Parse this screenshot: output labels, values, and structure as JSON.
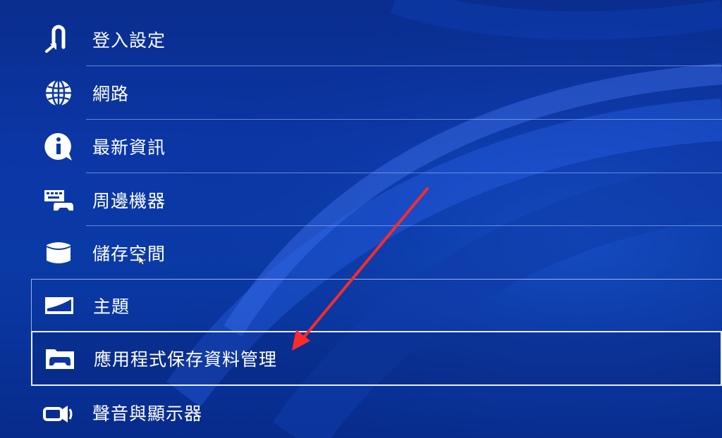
{
  "menu": {
    "items": [
      {
        "label": "登入設定",
        "icon": "sign-in-icon"
      },
      {
        "label": "網路",
        "icon": "globe-icon"
      },
      {
        "label": "最新資訊",
        "icon": "info-icon"
      },
      {
        "label": "周邊機器",
        "icon": "keyboard-controller-icon"
      },
      {
        "label": "儲存空間",
        "icon": "storage-icon"
      },
      {
        "label": "主題",
        "icon": "theme-icon"
      },
      {
        "label": "應用程式保存資料管理",
        "icon": "folder-controller-icon"
      },
      {
        "label": "聲音與顯示器",
        "icon": "speaker-display-icon"
      }
    ],
    "selected_label": "應用程式保存資料管理"
  },
  "colors": {
    "background": "#0a3aa6",
    "annotation_arrow": "#ff2a2a",
    "selection_border": "#e8f0ff"
  }
}
